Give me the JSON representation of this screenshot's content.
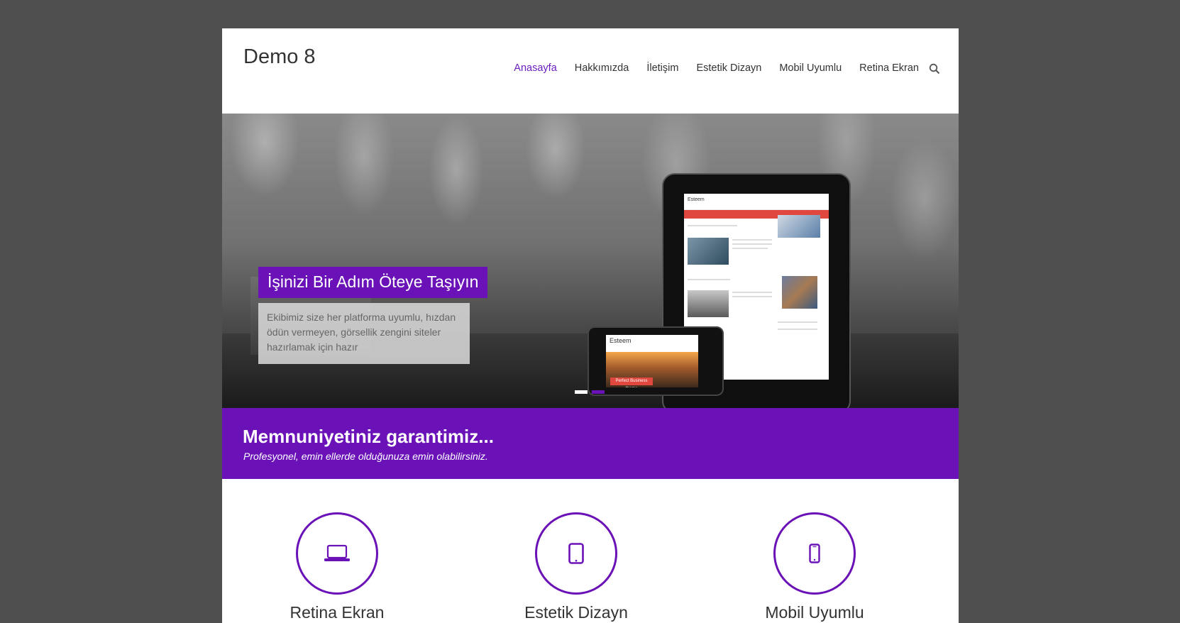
{
  "header": {
    "site_title": "Demo 8",
    "nav": [
      "Anasayfa",
      "Hakkımızda",
      "İletişim",
      "Estetik Dizayn",
      "Mobil Uyumlu",
      "Retina Ekran"
    ],
    "active_nav": "Anasayfa",
    "search_icon": "search-icon"
  },
  "slider": {
    "title": "İşinizi Bir Adım Öteye Taşıyın",
    "description": "Ekibimiz size her platforma uyumlu, hızdan ödün vermeyen, görsellik zengini siteler hazırlamak için hazır",
    "tablet_logo": "Esteem",
    "phone_logo": "Esteem",
    "phone_button": "Perfect Business theme",
    "dots": 2,
    "active_dot": 1
  },
  "band": {
    "title": "Memnuniyetiniz garantimiz...",
    "subtitle": "Profesyonel, emin ellerde olduğunuza emin olabilirsiniz."
  },
  "features": [
    {
      "title": "Retina Ekran",
      "icon": "laptop-icon"
    },
    {
      "title": "Estetik Dizayn",
      "icon": "tablet-icon"
    },
    {
      "title": "Mobil Uyumlu",
      "icon": "mobile-icon"
    }
  ],
  "colors": {
    "accent": "#6a12b8",
    "background": "#4f4f4f"
  }
}
